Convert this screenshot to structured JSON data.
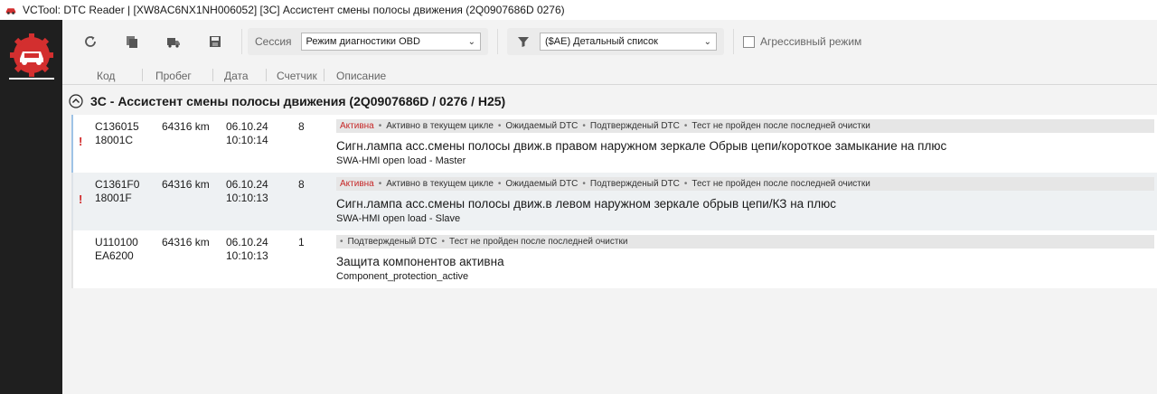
{
  "window": {
    "title": "VCTool: DTC Reader | [XW8AC6NX1NH006052] [3C] Ассистент смены полосы движения (2Q0907686D 0276)"
  },
  "sidebar": {
    "logo_icon": "car-diagnostics-logo-icon"
  },
  "toolbar": {
    "session_label": "Сессия",
    "session_value": "Режим диагностики OBD",
    "filter_value": "($AE) Детальный список",
    "aggressive_label": "Агрессивный режим"
  },
  "columns": {
    "code": "Код",
    "mileage": "Пробег",
    "date": "Дата",
    "counter": "Счетчик",
    "description": "Описание"
  },
  "group": {
    "title": "3C - Ассистент смены полосы движения (2Q0907686D / 0276 / H25)"
  },
  "rows": [
    {
      "code": "C136015",
      "subcode": "18001C",
      "mileage": "64316 km",
      "date": "06.10.24",
      "time": "10:10:14",
      "counter": "8",
      "tags": [
        "Активна",
        "Активно в текущем цикле",
        "Ожидаемый DTC",
        "Подтвержденый DTC",
        "Тест не пройден после последней очистки"
      ],
      "description": "Сигн.лампа асс.смены полосы движ.в правом наружном зеркале Обрыв цепи/короткое замыкание на плюс",
      "detail": "SWA-HMI open load - Master",
      "warning": "!"
    },
    {
      "code": "C1361F0",
      "subcode": "18001F",
      "mileage": "64316 km",
      "date": "06.10.24",
      "time": "10:10:13",
      "counter": "8",
      "tags": [
        "Активна",
        "Активно в текущем цикле",
        "Ожидаемый DTC",
        "Подтвержденый DTC",
        "Тест не пройден после последней очистки"
      ],
      "description": "Сигн.лампа асс.смены полосы движ.в левом наружном зеркале обрыв цепи/КЗ на плюс",
      "detail": "SWA-HMI open load - Slave",
      "warning": "!"
    },
    {
      "code": "U110100",
      "subcode": "EA6200",
      "mileage": "64316 km",
      "date": "06.10.24",
      "time": "10:10:13",
      "counter": "1",
      "tags": [
        "Подтвержденый DTC",
        "Тест не пройден после последней очистки"
      ],
      "description": "Защита компонентов активна",
      "detail": "Component_protection_active"
    }
  ],
  "colors": {
    "active_tag": "#c62828",
    "warning": "#d12828",
    "accent_blue": "#9ec3e6",
    "sidebar_bg": "#1f1f1f",
    "logo_red": "#d32f2f"
  }
}
